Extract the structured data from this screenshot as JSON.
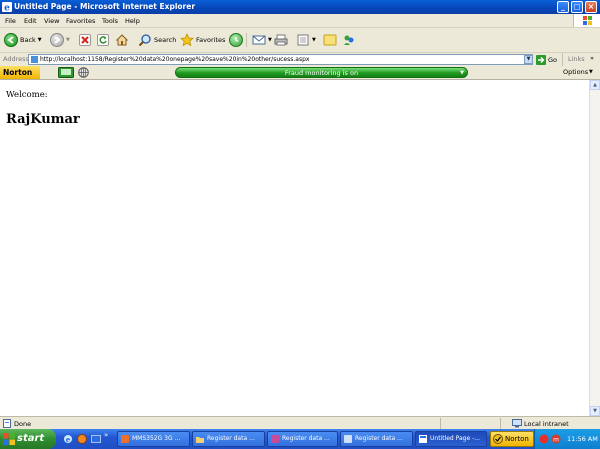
{
  "window": {
    "title": "Untitled Page - Microsoft Internet Explorer",
    "minimize_glyph": "_",
    "maximize_glyph": "□",
    "close_glyph": "×"
  },
  "menu": [
    "File",
    "Edit",
    "View",
    "Favorites",
    "Tools",
    "Help"
  ],
  "toolbar": {
    "back_label": "Back",
    "search_label": "Search",
    "favorites_label": "Favorites"
  },
  "address": {
    "label": "Address",
    "url": "http://localhost:1158/Register%20data%20onepage%20save%20in%20other/sucess.aspx",
    "go_label": "Go",
    "links_label": "Links"
  },
  "norton": {
    "logo": "Norton",
    "fraud_status": "Fraud monitoring is on",
    "options_label": "Options"
  },
  "content": {
    "welcome": "Welcome:",
    "username": "RajKumar"
  },
  "status": {
    "text": "Done",
    "zone": "Local intranet"
  },
  "taskbar": {
    "start_label": "start",
    "tasks": [
      "MMS352G 3G ...",
      "Register data ...",
      "Register data ...",
      "Register data ...",
      "Untitled Page -..."
    ],
    "norton_label": "Norton",
    "clock": "11:56 AM"
  },
  "colors": {
    "titlebar": "#0645b8",
    "chrome": "#ece9d8",
    "fraud_green": "#1f9a1f",
    "taskbar_blue": "#2457d0",
    "start_green": "#2f8e2f"
  }
}
